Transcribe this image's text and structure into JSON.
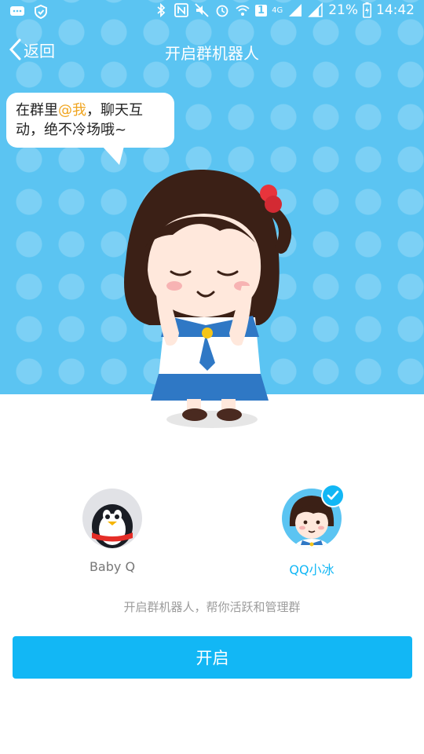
{
  "status_bar": {
    "battery": "21%",
    "time": "14:42",
    "network": "4G",
    "sim": "1"
  },
  "header": {
    "back_label": "返回",
    "title": "开启群机器人"
  },
  "bubble": {
    "line1_prefix": "在群里",
    "mention": "@我",
    "line1_suffix": "，聊天互",
    "line2": "动，绝不冷场哦~"
  },
  "robots": [
    {
      "name": "Baby Q",
      "selected": false
    },
    {
      "name": "QQ小冰",
      "selected": true
    }
  ],
  "hint": "开启群机器人，帮你活跃和管理群",
  "action": {
    "label": "开启"
  },
  "colors": {
    "hero_bg": "#5bc4f2",
    "accent": "#12b7f5",
    "mention": "#f0a51f",
    "hint_text": "#9c9c9c"
  }
}
